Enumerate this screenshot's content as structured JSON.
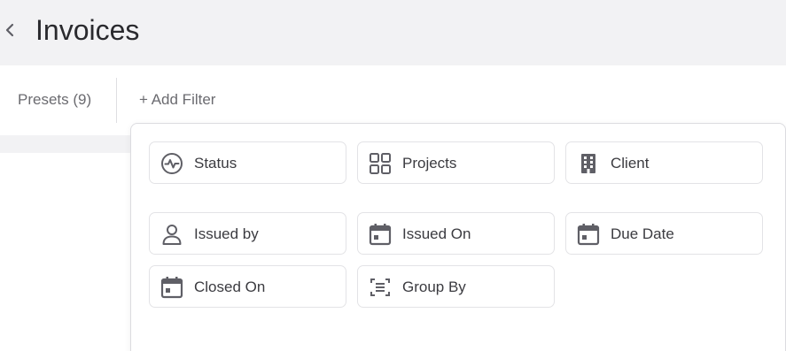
{
  "header": {
    "title": "Invoices",
    "back_icon": "chevron-left-icon"
  },
  "filter_bar": {
    "presets_label": "Presets (9)",
    "add_filter_label": "+ Add Filter"
  },
  "filter_menu": {
    "options": [
      {
        "label": "Status",
        "icon": "activity-icon"
      },
      {
        "label": "Projects",
        "icon": "grid-icon"
      },
      {
        "label": "Client",
        "icon": "building-icon"
      },
      {
        "label": "Issued by",
        "icon": "person-icon"
      },
      {
        "label": "Issued On",
        "icon": "calendar-icon"
      },
      {
        "label": "Due Date",
        "icon": "calendar-icon"
      },
      {
        "label": "Closed On",
        "icon": "calendar-icon"
      },
      {
        "label": "Group By",
        "icon": "group-icon"
      }
    ]
  },
  "colors": {
    "header_bg": "#f2f2f4",
    "icon_color": "#5f5f66",
    "border": "#e3e3e6"
  }
}
